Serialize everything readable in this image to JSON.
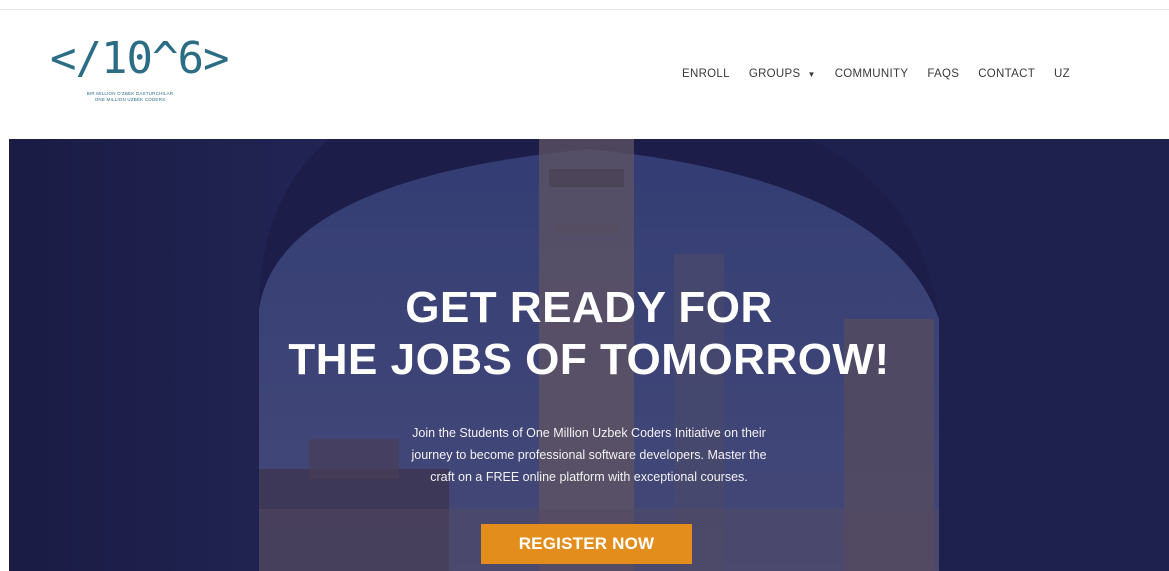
{
  "logo": {
    "mark": "</10^6>",
    "line1": "BIR MILLION O'ZBEK DASTURCHILAR",
    "line2": "ONE MILLION UZBEK CODERS"
  },
  "nav": {
    "items": [
      {
        "label": "ENROLL"
      },
      {
        "label": "GROUPS"
      },
      {
        "label": "COMMUNITY"
      },
      {
        "label": "FAQS"
      },
      {
        "label": "CONTACT"
      },
      {
        "label": "UZ"
      }
    ]
  },
  "hero": {
    "title_line1": "GET READY FOR",
    "title_line2": "THE JOBS OF TOMORROW!",
    "subtitle_line1": "Join the Students of One Million Uzbek Coders Initiative on their",
    "subtitle_line2": "journey to become professional software developers. Master the",
    "subtitle_line3": "craft on a FREE online platform with exceptional courses.",
    "cta_label": "REGISTER NOW"
  },
  "colors": {
    "brand": "#2b6d85",
    "accent": "#e38d1d",
    "hero_overlay": "#1e1f4a"
  },
  "icons": {
    "groups_dropdown": "caret-down-icon"
  }
}
